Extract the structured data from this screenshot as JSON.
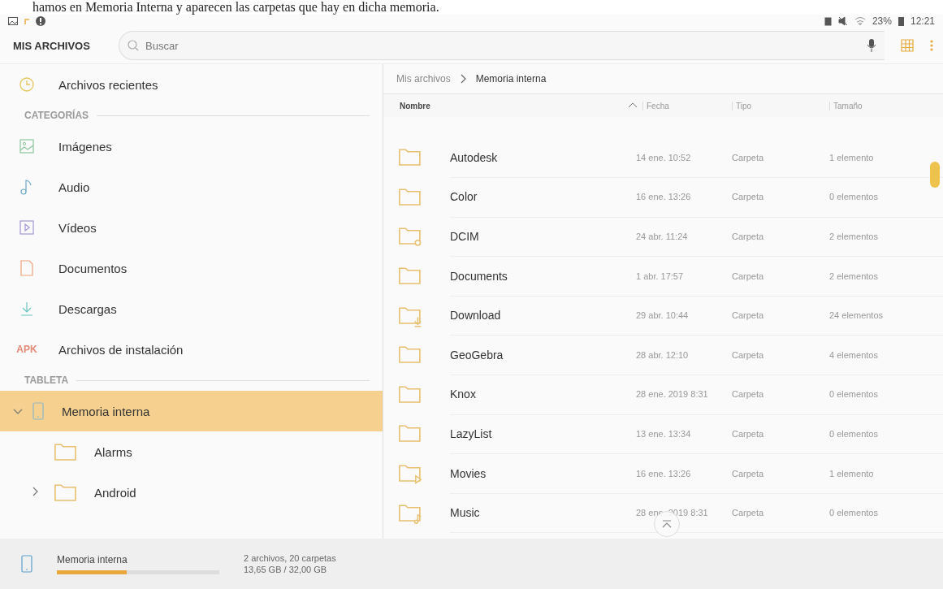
{
  "caption": "hamos en Memoria Interna y aparecen las carpetas que hay en dicha memoria.",
  "status_bar": {
    "battery_percent": "23%",
    "time": "12:21"
  },
  "toolbar": {
    "title": "MIS ARCHIVOS",
    "search": {
      "placeholder": "Buscar"
    }
  },
  "sidebar": {
    "recent": {
      "label": "Archivos recientes"
    },
    "sections": [
      {
        "title": "CATEGORÍAS",
        "items": [
          {
            "kind": "images",
            "label": "Imágenes"
          },
          {
            "kind": "audio",
            "label": "Audio"
          },
          {
            "kind": "videos",
            "label": "Vídeos"
          },
          {
            "kind": "documents",
            "label": "Documentos"
          },
          {
            "kind": "downloads",
            "label": "Descargas"
          },
          {
            "kind": "apk",
            "badge": "APK",
            "label": "Archivos de instalación"
          }
        ]
      },
      {
        "title": "TABLETA",
        "tree": [
          {
            "label": "Memoria interna",
            "selected": true,
            "expanded": true,
            "children": [
              {
                "label": "Alarms",
                "selected": false,
                "has_children": false
              },
              {
                "label": "Android",
                "selected": false,
                "has_children": true
              }
            ]
          }
        ]
      }
    ]
  },
  "breadcrumb": [
    "Mis archivos",
    "Memoria interna"
  ],
  "table": {
    "columns": [
      {
        "label": "Nombre",
        "sorted": true
      },
      {
        "label": "Fecha",
        "sorted": false
      },
      {
        "label": "Tipo",
        "sorted": false
      },
      {
        "label": "Tamaño",
        "sorted": false
      }
    ],
    "rows": [
      {
        "kind": "folder",
        "name": "Autodesk",
        "date": "14 ene. 10:52",
        "type": "Carpeta",
        "size": "1 elemento"
      },
      {
        "kind": "folder",
        "name": "Color",
        "date": "16 ene. 13:26",
        "type": "Carpeta",
        "size": "0 elementos"
      },
      {
        "kind": "camera",
        "name": "DCIM",
        "date": "24 abr. 11:24",
        "type": "Carpeta",
        "size": "2 elementos"
      },
      {
        "kind": "folder",
        "name": "Documents",
        "date": "1 abr. 17:57",
        "type": "Carpeta",
        "size": "2 elementos"
      },
      {
        "kind": "download",
        "name": "Download",
        "date": "29 abr. 10:44",
        "type": "Carpeta",
        "size": "24 elementos"
      },
      {
        "kind": "folder",
        "name": "GeoGebra",
        "date": "28 abr. 12:10",
        "type": "Carpeta",
        "size": "4 elementos"
      },
      {
        "kind": "folder",
        "name": "Knox",
        "date": "28 ene. 2019 8:31",
        "type": "Carpeta",
        "size": "0 elementos"
      },
      {
        "kind": "folder",
        "name": "LazyList",
        "date": "13 ene. 13:34",
        "type": "Carpeta",
        "size": "0 elementos"
      },
      {
        "kind": "video",
        "name": "Movies",
        "date": "16 ene. 13:26",
        "type": "Carpeta",
        "size": "1 elemento"
      },
      {
        "kind": "music",
        "name": "Music",
        "date": "28 ene. 2019 8:31",
        "type": "Carpeta",
        "size": "0 elementos"
      }
    ]
  },
  "storage": {
    "name": "Memoria interna",
    "level": 0.43,
    "files": "2 archivos, 20 carpetas",
    "usage": "13,65 GB / 32,00 GB"
  }
}
